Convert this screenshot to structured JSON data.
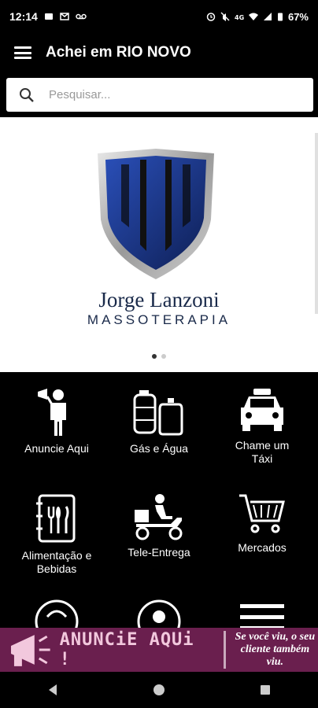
{
  "status": {
    "time": "12:14",
    "battery": "67%"
  },
  "appbar": {
    "title": "Achei em RIO NOVO"
  },
  "search": {
    "placeholder": "Pesquisar..."
  },
  "banner": {
    "brand_name": "Jorge Lanzoni",
    "brand_subtitle": "MASSOTERAPIA"
  },
  "categories": [
    {
      "label": "Anuncie Aqui",
      "icon": "megaphone-man-icon"
    },
    {
      "label": "Gás e Água",
      "icon": "gas-water-icon"
    },
    {
      "label": "Chame um Táxi",
      "icon": "taxi-icon"
    },
    {
      "label": "Alimentação e Bebidas",
      "icon": "menu-cutlery-icon"
    },
    {
      "label": "Tele-Entrega",
      "icon": "delivery-scooter-icon"
    },
    {
      "label": "Mercados",
      "icon": "cart-icon"
    }
  ],
  "ad": {
    "label": "ANUNCiE AQUi !",
    "slogan": "Se você viu, o seu cliente também viu."
  },
  "colors": {
    "ad_bar": "#6a1f4e",
    "background": "#000000",
    "brand_blue": "#1a3a8a"
  }
}
